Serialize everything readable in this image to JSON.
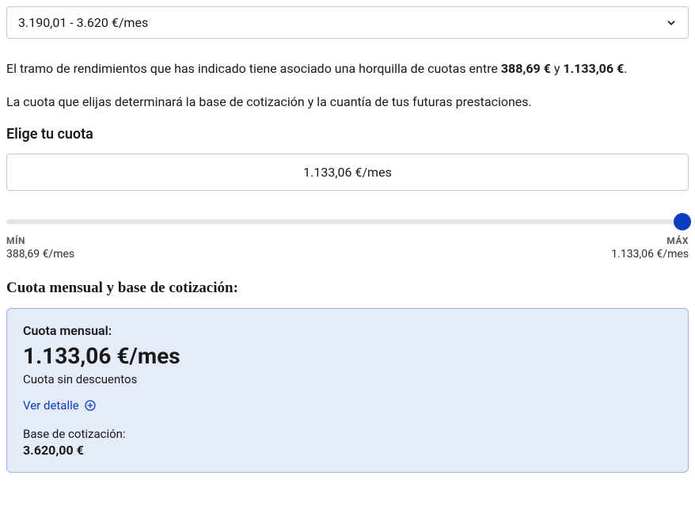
{
  "income_range_select": {
    "value": "3.190,01 - 3.620 €/mes"
  },
  "description": {
    "line1_pre": "El tramo de rendimientos que has indicado tiene asociado una horquilla de cuotas entre ",
    "min_bold": "388,69 €",
    "line1_mid": " y ",
    "max_bold": "1.133,06 €",
    "line1_end": ".",
    "line2": "La cuota que elijas determinará la base de cotización y la cuantía de tus futuras prestaciones."
  },
  "choose_section": {
    "label": "Elige tu cuota",
    "selected_value": "1.133,06 €/mes"
  },
  "slider": {
    "min_label": "MÍN",
    "min_value": "388,69 €/mes",
    "max_label": "MÁX",
    "max_value": "1.133,06 €/mes"
  },
  "results": {
    "title": "Cuota mensual y base de cotización:",
    "cuota_label": "Cuota mensual:",
    "cuota_value": "1.133,06 €/mes",
    "cuota_note": "Cuota sin descuentos",
    "detail_link": "Ver detalle",
    "base_label": "Base de cotización:",
    "base_value": "3.620,00 €"
  }
}
